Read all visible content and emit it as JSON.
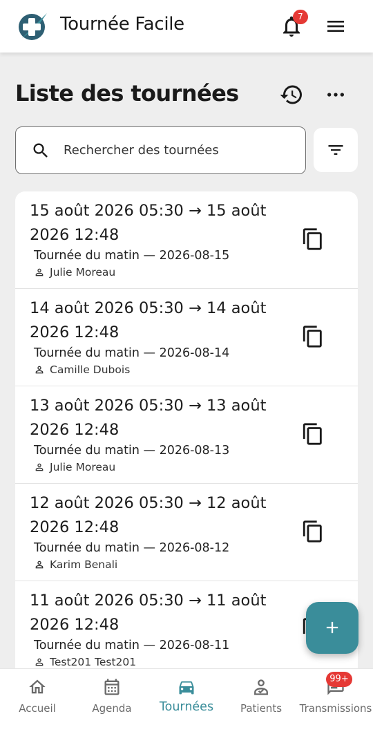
{
  "header": {
    "app_title": "Tournée Facile",
    "notification_count": "7"
  },
  "page": {
    "title": "Liste des tournées"
  },
  "search": {
    "placeholder": "Rechercher des tournées"
  },
  "tours": [
    {
      "range": "15 août 2026 05:30 → 15 août 2026 12:48",
      "subtitle": "Tournée du matin — 2026-08-15",
      "person": "Julie Moreau"
    },
    {
      "range": "14 août 2026 05:30 → 14 août 2026 12:48",
      "subtitle": "Tournée du matin — 2026-08-14",
      "person": "Camille Dubois"
    },
    {
      "range": "13 août 2026 05:30 → 13 août 2026 12:48",
      "subtitle": "Tournée du matin — 2026-08-13",
      "person": "Julie Moreau"
    },
    {
      "range": "12 août 2026 05:30 → 12 août 2026 12:48",
      "subtitle": "Tournée du matin — 2026-08-12",
      "person": "Karim Benali"
    },
    {
      "range": "11 août 2026 05:30 → 11 août 2026 12:48",
      "subtitle": "Tournée du matin — 2026-08-11",
      "person": "Test201 Test201"
    }
  ],
  "nav": {
    "items": [
      {
        "label": "Accueil",
        "icon": "home-icon"
      },
      {
        "label": "Agenda",
        "icon": "calendar-icon"
      },
      {
        "label": "Tournées",
        "icon": "car-icon",
        "active": true
      },
      {
        "label": "Patients",
        "icon": "patient-icon"
      },
      {
        "label": "Transmissions",
        "icon": "chat-icon"
      }
    ],
    "transmissions_badge": "99+"
  },
  "colors": {
    "accent": "#3a8d9a",
    "badge": "#e53935",
    "logo_dark": "#2e5f73"
  }
}
